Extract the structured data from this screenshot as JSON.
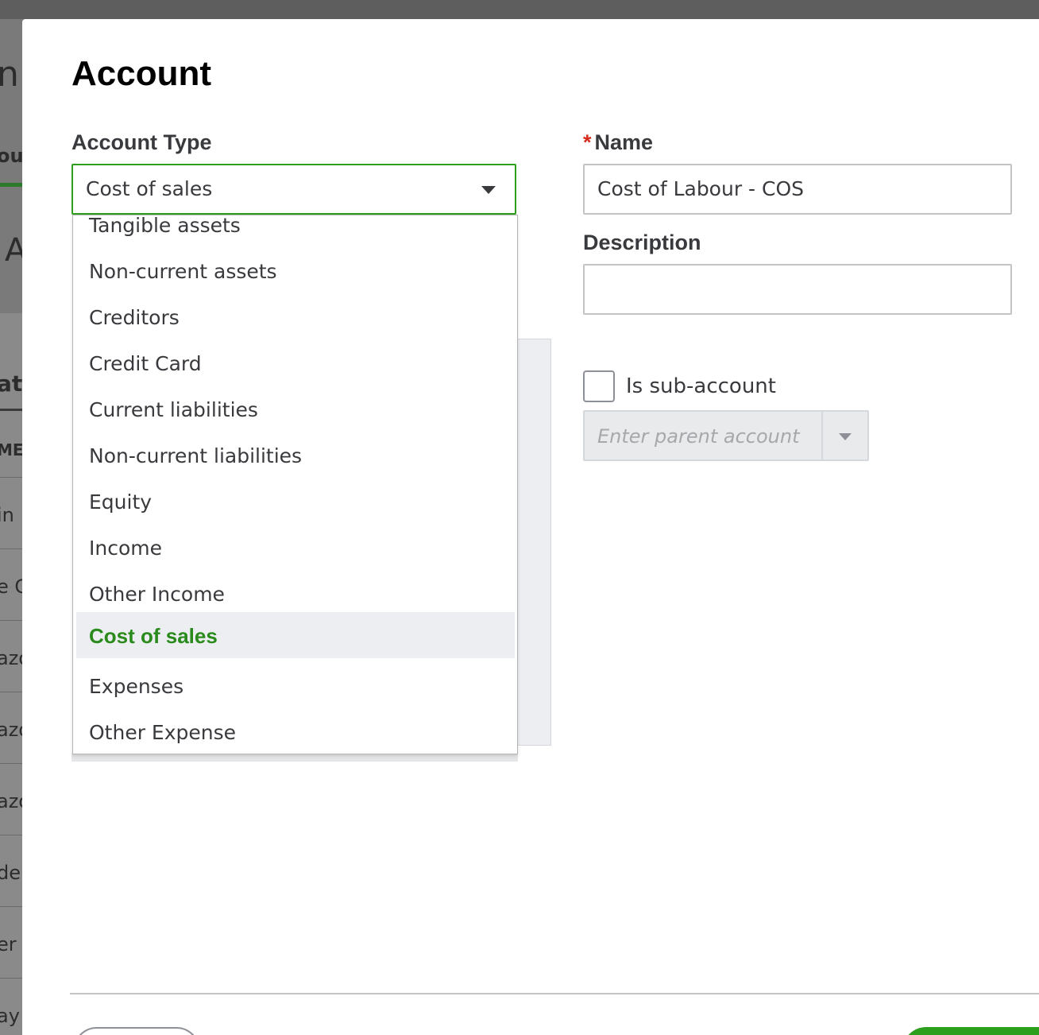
{
  "background": {
    "fragments": [
      "n",
      "ou",
      "A",
      "at",
      "ME",
      "in",
      "e C",
      "azo",
      "azo",
      "azo",
      "de",
      "er",
      "ay"
    ]
  },
  "modal": {
    "title": "Account",
    "account_type": {
      "label": "Account Type",
      "selected": "Cost of sales",
      "options": [
        "Tangible assets",
        "Non-current assets",
        "Creditors",
        "Credit Card",
        "Current liabilities",
        "Non-current liabilities",
        "Equity",
        "Income",
        "Other Income",
        "Cost of sales",
        "Expenses",
        "Other Expense"
      ]
    },
    "name": {
      "required_marker": "*",
      "label": "Name",
      "value": "Cost of Labour - COS"
    },
    "description": {
      "label": "Description",
      "value": ""
    },
    "sub_account": {
      "label": "Is sub-account",
      "checked": false,
      "parent_placeholder": "Enter parent account"
    }
  },
  "colors": {
    "accent_green": "#2ca01c",
    "selected_text_green": "#2a8a1c",
    "required_red": "#d52b1e"
  }
}
